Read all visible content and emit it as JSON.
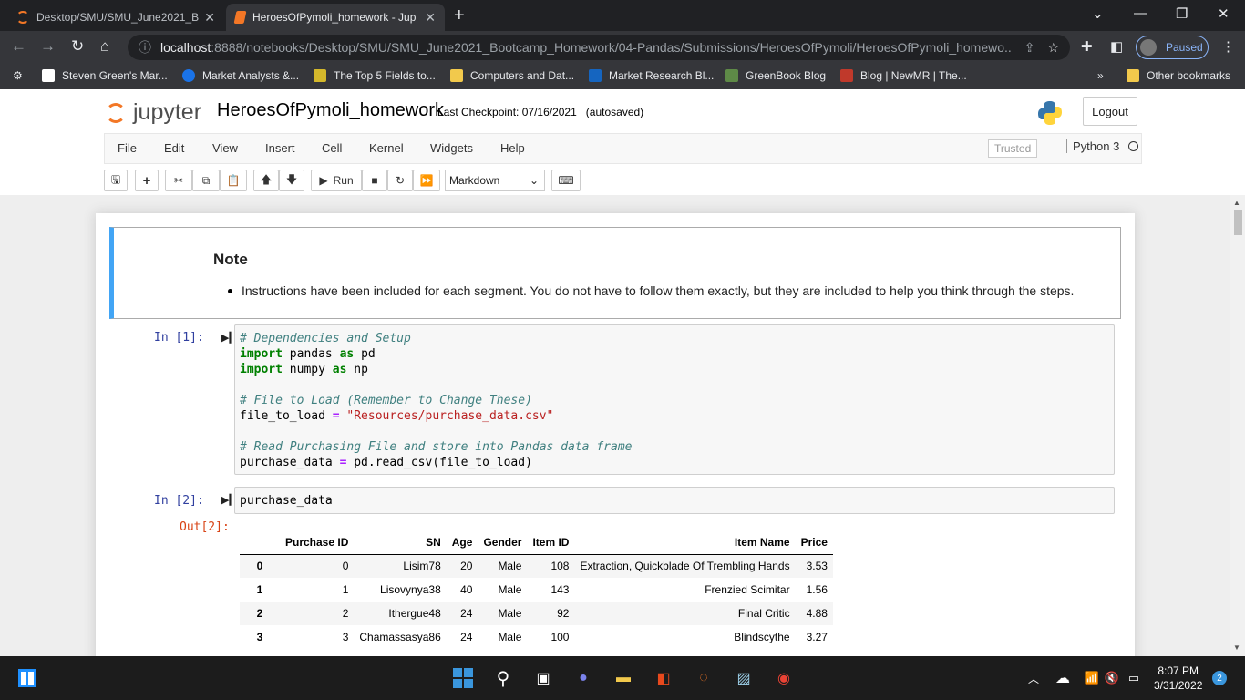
{
  "browser": {
    "tabs": [
      {
        "title": "Desktop/SMU/SMU_June2021_Bo"
      },
      {
        "title": "HeroesOfPymoli_homework - Jup"
      }
    ],
    "url_host": "localhost",
    "url_rest": ":8888/notebooks/Desktop/SMU/SMU_June2021_Bootcamp_Homework/04-Pandas/Submissions/HeroesOfPymoli/HeroesOfPymoli_homewo...",
    "profile_label": "Paused",
    "bookmarks": [
      {
        "label": "Steven Green's Mar..."
      },
      {
        "label": "Market Analysts &..."
      },
      {
        "label": "The Top 5 Fields to..."
      },
      {
        "label": "Computers and Dat..."
      },
      {
        "label": "Market Research Bl..."
      },
      {
        "label": "GreenBook Blog"
      },
      {
        "label": "Blog | NewMR | The..."
      }
    ],
    "bookmarks_more": "»",
    "other_bookmarks": "Other bookmarks"
  },
  "jupyter": {
    "logo_text": "jupyter",
    "notebook_name": "HeroesOfPymoli_homework",
    "checkpoint": "Last Checkpoint: 07/16/2021",
    "autosaved": "(autosaved)",
    "logout": "Logout",
    "menu": [
      "File",
      "Edit",
      "View",
      "Insert",
      "Cell",
      "Kernel",
      "Widgets",
      "Help"
    ],
    "trusted": "Trusted",
    "kernel_name": "Python 3",
    "run_label": "Run",
    "cell_type": "Markdown"
  },
  "notebook": {
    "note_heading": "Note",
    "note_text": "Instructions have been included for each segment. You do not have to follow them exactly, but they are included to help you think through the steps.",
    "cell1_prompt": "In [1]:",
    "cell1_lines": {
      "l1": "# Dependencies and Setup",
      "l2a": "import",
      "l2b": " pandas ",
      "l2c": "as",
      "l2d": " pd",
      "l3a": "import",
      "l3b": " numpy ",
      "l3c": "as",
      "l3d": " np",
      "l5": "# File to Load (Remember to Change These)",
      "l6a": "file_to_load ",
      "l6b": "=",
      "l6c": " \"Resources/purchase_data.csv\"",
      "l8": "# Read Purchasing File and store into Pandas data frame",
      "l9a": "purchase_data ",
      "l9b": "=",
      "l9c": " pd.read_csv(file_to_load)"
    },
    "cell2_prompt": "In [2]:",
    "cell2_code": "purchase_data",
    "out2_prompt": "Out[2]:",
    "table": {
      "columns": [
        "",
        "Purchase ID",
        "SN",
        "Age",
        "Gender",
        "Item ID",
        "Item Name",
        "Price"
      ],
      "rows": [
        [
          "0",
          "0",
          "Lisim78",
          "20",
          "Male",
          "108",
          "Extraction, Quickblade Of Trembling Hands",
          "3.53"
        ],
        [
          "1",
          "1",
          "Lisovynya38",
          "40",
          "Male",
          "143",
          "Frenzied Scimitar",
          "1.56"
        ],
        [
          "2",
          "2",
          "Ithergue48",
          "24",
          "Male",
          "92",
          "Final Critic",
          "4.88"
        ],
        [
          "3",
          "3",
          "Chamassasya86",
          "24",
          "Male",
          "100",
          "Blindscythe",
          "3.27"
        ]
      ]
    }
  },
  "taskbar": {
    "time": "8:07 PM",
    "date": "3/31/2022",
    "notifications": "2"
  }
}
